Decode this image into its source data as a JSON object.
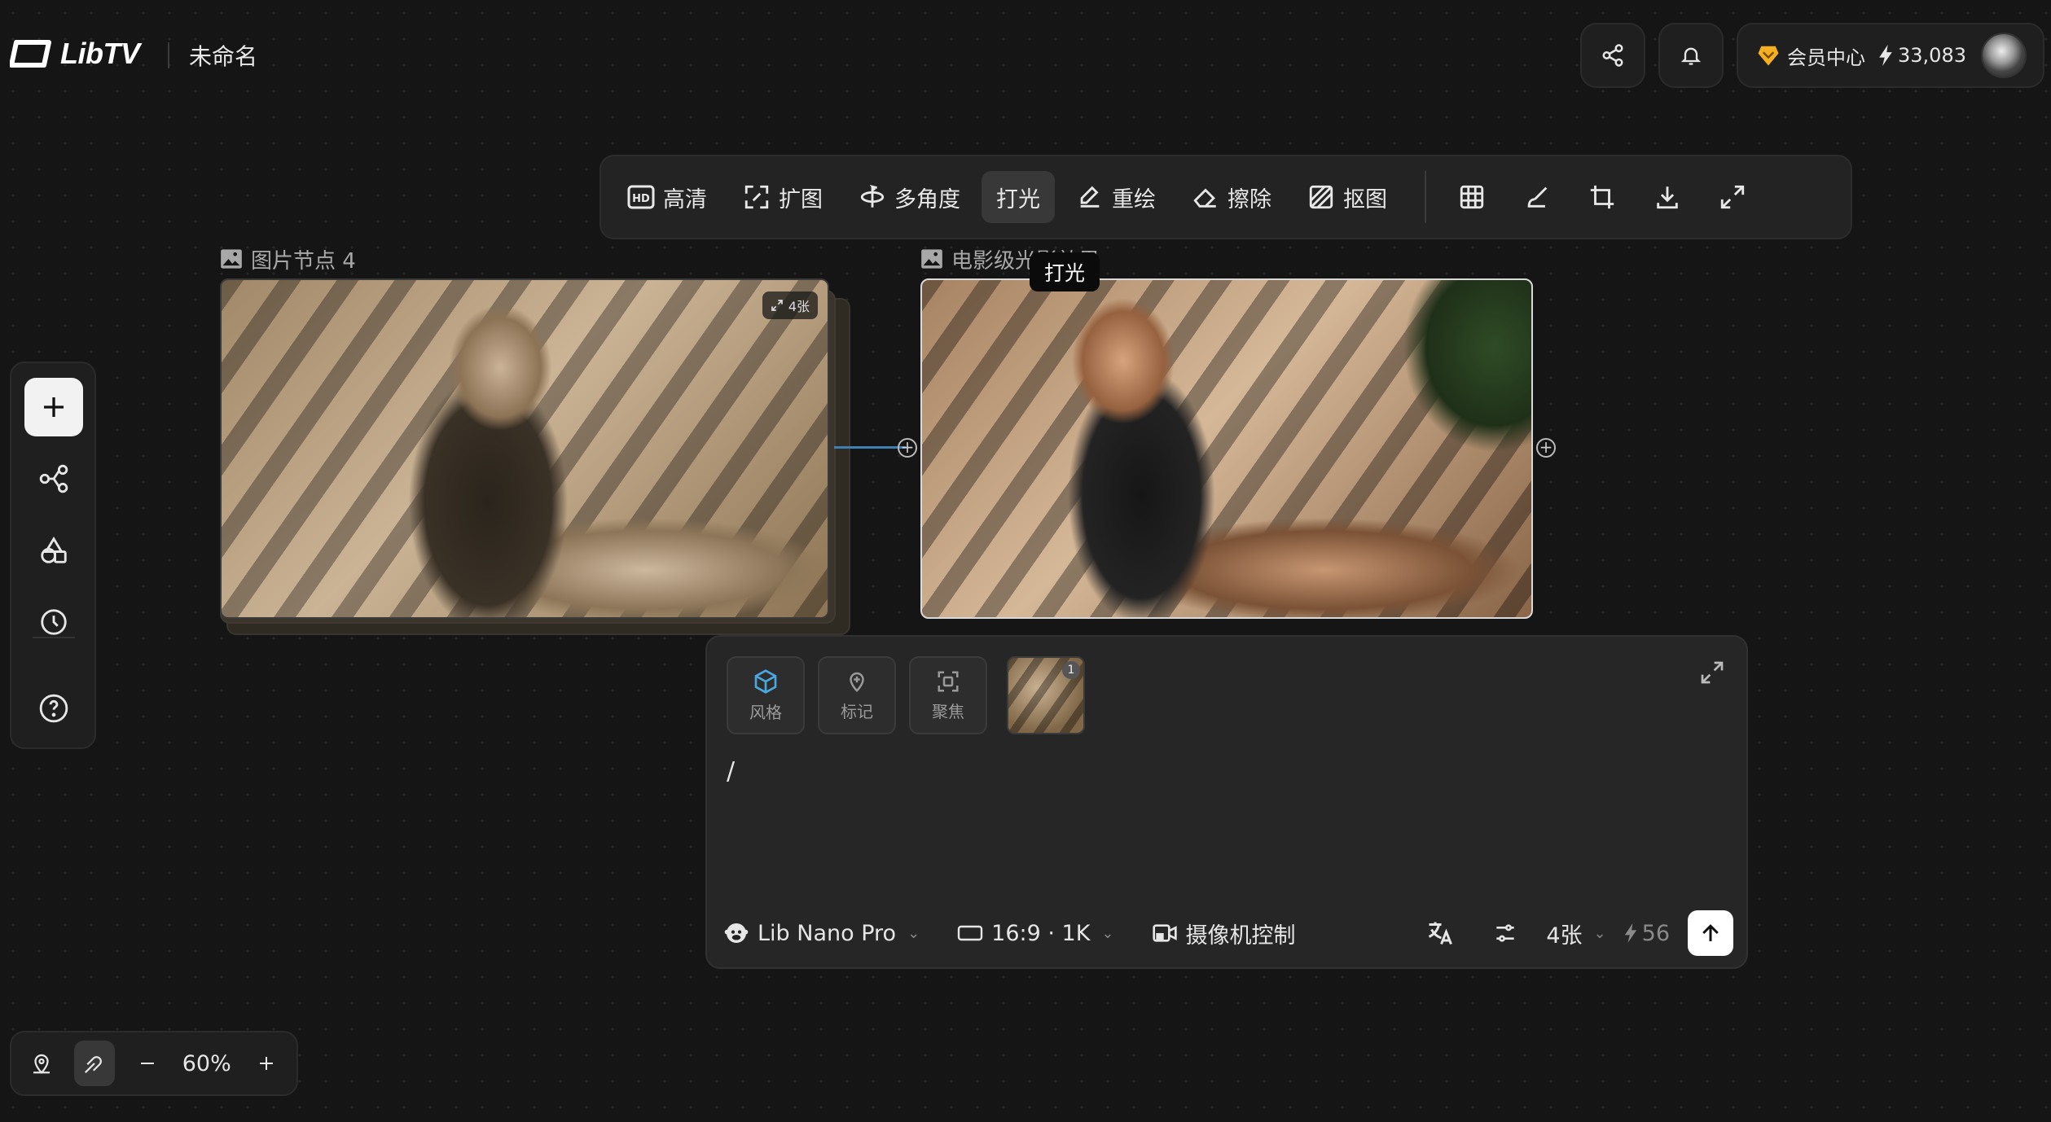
{
  "header": {
    "brand": "LibTV",
    "project_name": "未命名",
    "vip_label": "会员中心",
    "points": "33,083"
  },
  "toolbar": {
    "items": [
      {
        "label": "高清"
      },
      {
        "label": "扩图"
      },
      {
        "label": "多角度"
      },
      {
        "label": "打光"
      },
      {
        "label": "重绘"
      },
      {
        "label": "擦除"
      },
      {
        "label": "抠图"
      }
    ],
    "active": "打光",
    "tooltip": "打光"
  },
  "nodes": [
    {
      "label": "图片节点 4",
      "badge": "4张"
    },
    {
      "label": "电影级光影效果"
    }
  ],
  "zoom": {
    "value": "60%"
  },
  "panel": {
    "chips": [
      {
        "label": "风格"
      },
      {
        "label": "标记"
      },
      {
        "label": "聚焦"
      }
    ],
    "thumb_count": "1",
    "prompt": "/",
    "model": "Lib Nano Pro",
    "ratio": "16:9 · 1K",
    "camera": "摄像机控制",
    "count": "4张",
    "cost": "56"
  },
  "colors": {
    "accent_blue": "#3e7fb0",
    "vip_gold": "#f5b021",
    "cube_blue": "#4aa8e0"
  }
}
